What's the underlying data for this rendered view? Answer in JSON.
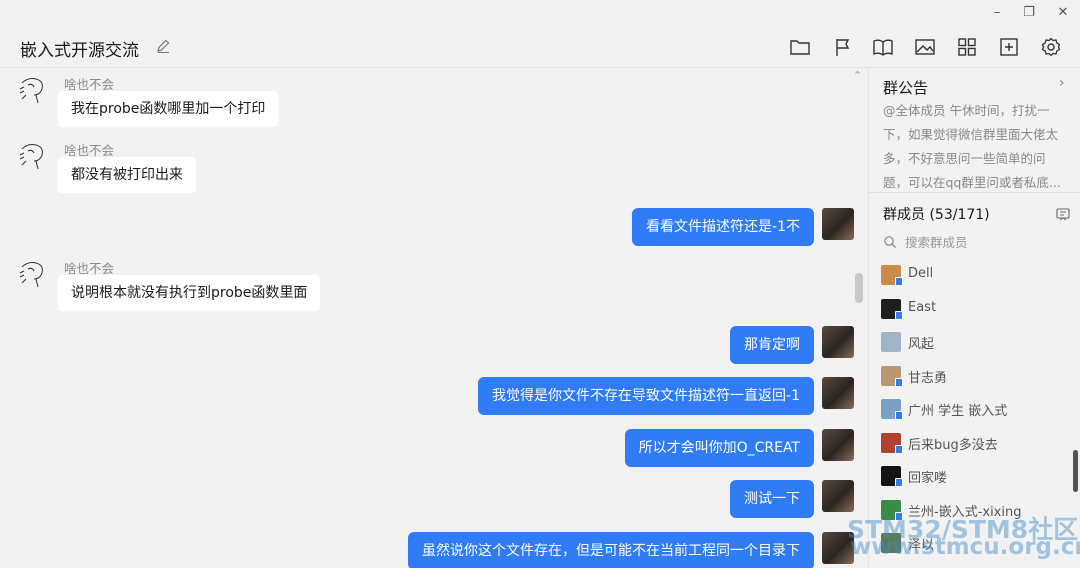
{
  "window": {
    "title": "嵌入式开源交流",
    "controls": [
      "minimize-icon",
      "restore-icon",
      "close-icon"
    ],
    "minimize_glyph": "–",
    "restore_glyph": "❐",
    "close_glyph": "✕"
  },
  "toolbar": {
    "icons": [
      "folder-icon",
      "flag-icon",
      "book-icon",
      "image-icon",
      "grid-icon",
      "add-square-icon",
      "gear-icon"
    ]
  },
  "messages": [
    {
      "side": "left",
      "sender": "啥也不会",
      "text": "我在probe函数哪里加一个打印"
    },
    {
      "side": "left",
      "sender": "啥也不会",
      "text": "都没有被打印出来"
    },
    {
      "side": "right",
      "text": "看看文件描述符还是-1不"
    },
    {
      "side": "left",
      "sender": "啥也不会",
      "text": "说明根本就没有执行到probe函数里面"
    },
    {
      "side": "right",
      "text": "那肯定啊"
    },
    {
      "side": "right",
      "text": "我觉得是你文件不存在导致文件描述符一直返回-1"
    },
    {
      "side": "right",
      "text": "所以才会叫你加O_CREAT"
    },
    {
      "side": "right",
      "text": "测试一下"
    },
    {
      "side": "right",
      "text": "虽然说你这个文件存在，但是可能不在当前工程同一个目录下"
    }
  ],
  "announcement": {
    "title": "群公告",
    "text": "@全体成员 午休时间，打扰一下，如果觉得微信群里面大佬太多，不好意思问一些简单的问题，可以在qq群里问或者私底..."
  },
  "members": {
    "title": "群成员 (53/171)",
    "search_placeholder": "搜索群成员",
    "list": [
      {
        "name": "Dell",
        "color": "#c98a4a"
      },
      {
        "name": "East",
        "color": "#1e1e1e"
      },
      {
        "name": "风起",
        "color": "#9fb4c8"
      },
      {
        "name": "甘志勇",
        "color": "#b89870"
      },
      {
        "name": "广州 学生 嵌入式",
        "color": "#7aa0c4"
      },
      {
        "name": "后来bug多没去",
        "color": "#b0412e"
      },
      {
        "name": "回家喽",
        "color": "#141414"
      },
      {
        "name": "兰州-嵌入式-xixing",
        "color": "#3a8a4a"
      },
      {
        "name": "泽以",
        "color": "#5a7a5a"
      }
    ]
  },
  "watermark": {
    "line1": "STM32/STM8社区",
    "line2": "www.stmcu.org.cn"
  },
  "colors": {
    "accent": "#2f7cf6",
    "background": "#f2f2f2",
    "bubble_left": "#ffffff"
  }
}
